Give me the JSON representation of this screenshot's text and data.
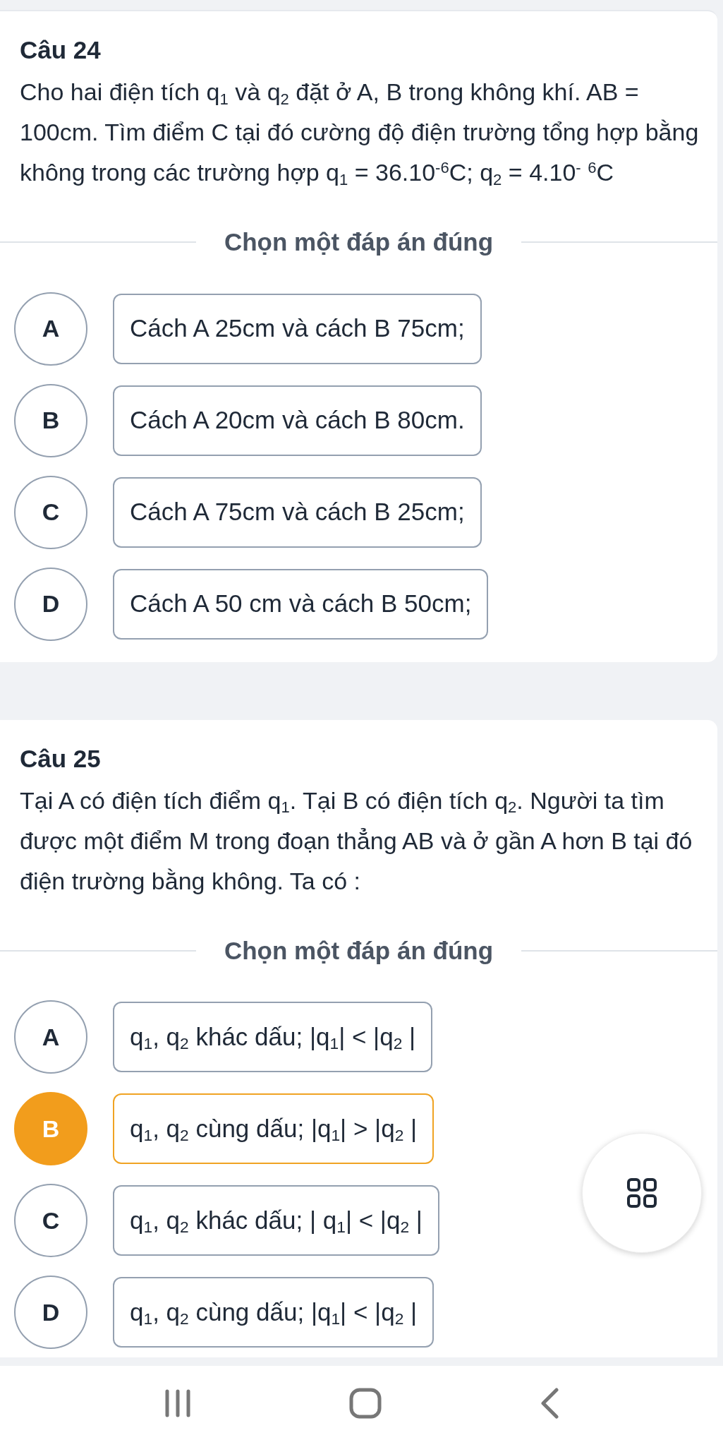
{
  "questions": [
    {
      "title": "Câu 24",
      "text": "Cho hai điện tích q$_{1}$ và q$_{2}$ đặt ở A, B trong không khí. AB = 100cm. Tìm điểm C tại đó cường độ điện trường tổng hợp bằng không trong các trường hợp q$_{1}$ = 36.10$^{-6}$C; q$_{2}$ = 4.10$^{-}$ $^{6}$C",
      "prompt": "Chọn một đáp án đúng",
      "options": [
        {
          "letter": "A",
          "text": "Cách A 25cm và cách B 75cm;",
          "selected": false
        },
        {
          "letter": "B",
          "text": "Cách A 20cm và cách B 80cm.",
          "selected": false
        },
        {
          "letter": "C",
          "text": "Cách A 75cm và cách B 25cm;",
          "selected": false
        },
        {
          "letter": "D",
          "text": "Cách A 50 cm và cách B 50cm;",
          "selected": false
        }
      ]
    },
    {
      "title": "Câu 25",
      "text": "Tại A có điện tích điểm q$_{1}$. Tại B có điện tích q$_{2}$. Người ta tìm được một điểm M trong đoạn thẳng AB và ở gần A hơn B tại đó điện trường bằng không. Ta có :",
      "prompt": "Chọn một đáp án đúng",
      "options": [
        {
          "letter": "A",
          "text": "q$_{1}$, q$_{2}$ khác dấu; |q$_{1}$| < |q$_{2}$ |",
          "selected": false
        },
        {
          "letter": "B",
          "text": "q$_{1}$, q$_{2}$ cùng dấu; |q$_{1}$| > |q$_{2}$ |",
          "selected": true
        },
        {
          "letter": "C",
          "text": "q$_{1}$, q$_{2}$ khác dấu; | q$_{1}$| < |q$_{2}$ |",
          "selected": false
        },
        {
          "letter": "D",
          "text": "q$_{1}$, q$_{2}$ cùng dấu; |q$_{1}$| < |q$_{2}$ |",
          "selected": false
        }
      ]
    }
  ]
}
